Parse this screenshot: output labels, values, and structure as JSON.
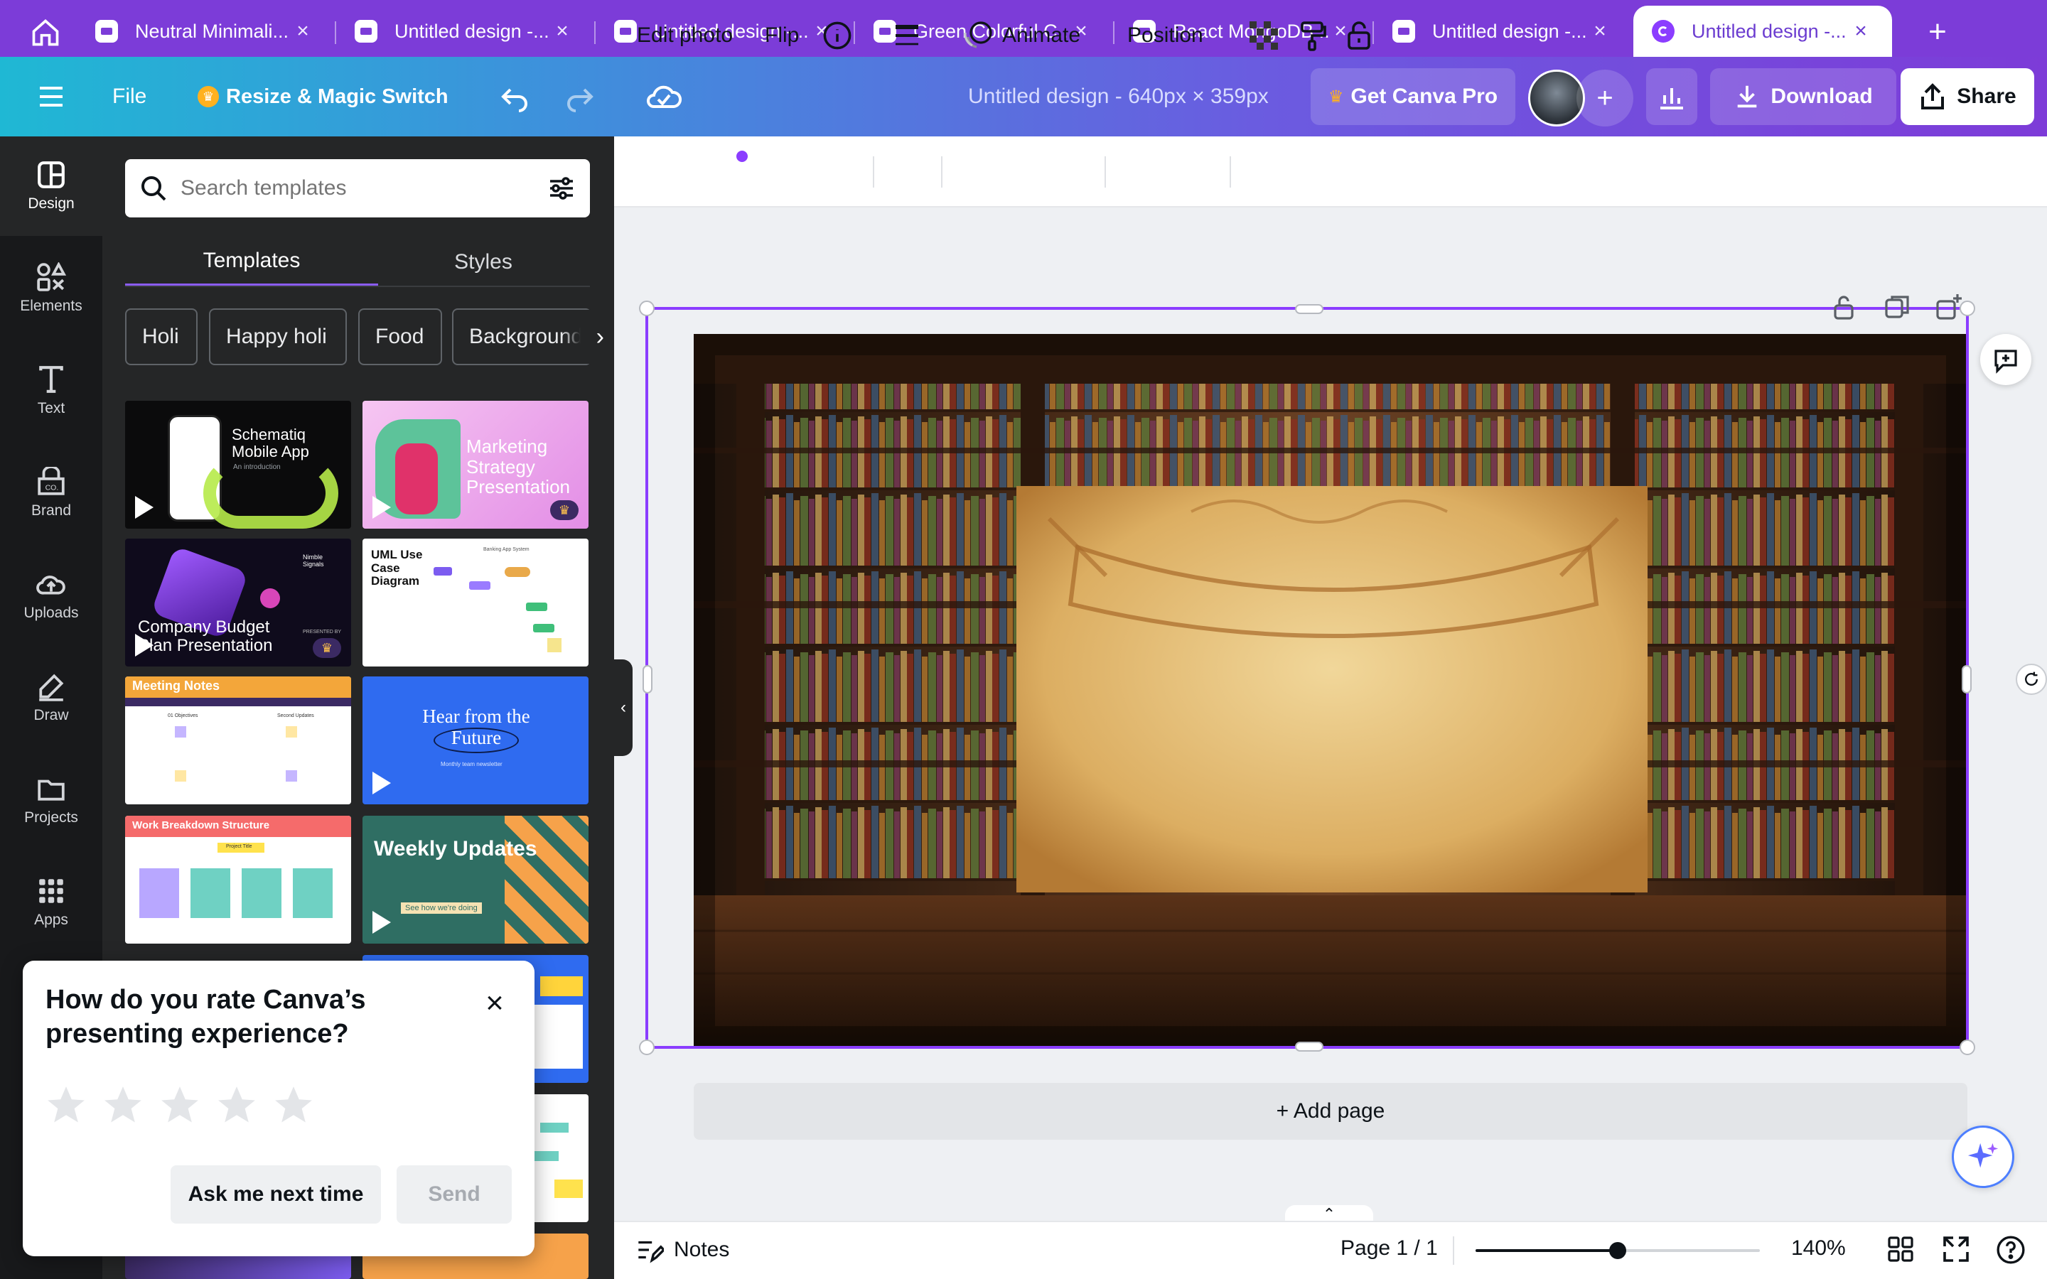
{
  "browser": {
    "tabs": [
      {
        "label": "Neutral Minimali..."
      },
      {
        "label": "Untitled design -..."
      },
      {
        "label": "Untitled design -..."
      },
      {
        "label": "Green Colorful C..."
      },
      {
        "label": "React MongoDB ..."
      },
      {
        "label": "Untitled design -..."
      },
      {
        "label": "Untitled design -..."
      }
    ],
    "new_tab": "+"
  },
  "header": {
    "file": "File",
    "resize": "Resize & Magic Switch",
    "doc_title": "Untitled design - 640px × 359px",
    "get_pro": "Get Canva Pro",
    "plus": "+",
    "download": "Download",
    "share": "Share"
  },
  "rail": {
    "items": [
      {
        "label": "Design"
      },
      {
        "label": "Elements"
      },
      {
        "label": "Text"
      },
      {
        "label": "Brand"
      },
      {
        "label": "Uploads"
      },
      {
        "label": "Draw"
      },
      {
        "label": "Projects"
      },
      {
        "label": "Apps"
      }
    ]
  },
  "panel": {
    "search_placeholder": "Search templates",
    "tabs": [
      "Templates",
      "Styles"
    ],
    "chips": [
      "Holi",
      "Happy holi",
      "Food",
      "Background"
    ],
    "templates": [
      {
        "title": "Schematiq Mobile App",
        "sub": "An introduction"
      },
      {
        "title": "Marketing Strategy Presentation"
      },
      {
        "title": "Company Budget Plan Presentation",
        "sub": "Nimble Signals",
        "sub2": "PRESENTED BY"
      },
      {
        "title": "UML Use Case Diagram",
        "sub": "Banking App System"
      },
      {
        "title": "Meeting Notes",
        "sub": "01 Objectives",
        "sub2": "Second Updates"
      },
      {
        "title": "Hear from the Future",
        "sub": "Monthly team newsletter"
      },
      {
        "title": "Work Breakdown Structure",
        "sub": "Project Title"
      },
      {
        "title": "Weekly Updates",
        "sub": "See how we're doing"
      }
    ]
  },
  "rating_popup": {
    "question": "How do you rate Canva’s presenting experience?",
    "close": "×",
    "stars": 5,
    "ask_later": "Ask me next time",
    "send": "Send"
  },
  "context_toolbar": {
    "edit_photo": "Edit photo",
    "flip": "Flip",
    "animate": "Animate",
    "position": "Position"
  },
  "canvas": {
    "add_page": "+ Add page"
  },
  "bottom": {
    "notes": "Notes",
    "page": "Page 1 / 1",
    "zoom": "140%",
    "zoom_level": 0.5
  },
  "colors": {
    "brand_purple": "#8b3dff",
    "tab_bar": "#7c3cd8",
    "panel_bg": "#252627"
  }
}
